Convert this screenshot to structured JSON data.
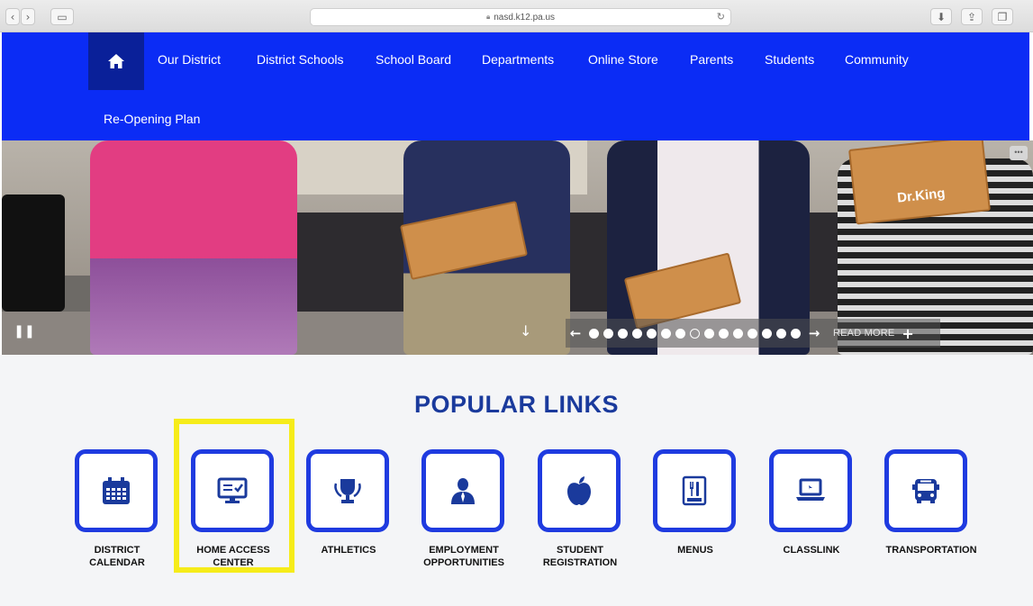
{
  "browser": {
    "url": "nasd.k12.pa.us"
  },
  "nav": {
    "items": [
      {
        "label": "Our District"
      },
      {
        "label": "District Schools"
      },
      {
        "label": "School Board"
      },
      {
        "label": "Departments"
      },
      {
        "label": "Online Store"
      },
      {
        "label": "Parents"
      },
      {
        "label": "Students"
      },
      {
        "label": "Community"
      },
      {
        "label": "Re-Opening Plan"
      }
    ]
  },
  "hero": {
    "read_more": "READ MORE",
    "slide_count": 15,
    "active_slide": 7,
    "book_title": "Dr.King"
  },
  "popular": {
    "title": "POPULAR LINKS",
    "links": [
      {
        "line1": "DISTRICT",
        "line2": "CALENDAR",
        "icon": "calendar-icon"
      },
      {
        "line1": "HOME ACCESS",
        "line2": "CENTER",
        "icon": "monitor-checklist-icon"
      },
      {
        "line1": "ATHLETICS",
        "line2": "",
        "icon": "trophy-icon"
      },
      {
        "line1": "EMPLOYMENT",
        "line2": "OPPORTUNITIES",
        "icon": "person-icon"
      },
      {
        "line1": "STUDENT",
        "line2": "REGISTRATION",
        "icon": "apple-icon"
      },
      {
        "line1": "MENUS",
        "line2": "",
        "icon": "menu-icon"
      },
      {
        "line1": "CLASSLINK",
        "line2": "",
        "icon": "laptop-icon"
      },
      {
        "line1": "TRANSPORTATION",
        "line2": "",
        "icon": "bus-icon"
      }
    ]
  },
  "colors": {
    "nav_blue": "#0b2cf5",
    "home_blue": "#0a2099",
    "tile_border": "#1f3be0",
    "title_blue": "#1a3a9c",
    "highlight_yellow": "#f6ec1a"
  }
}
